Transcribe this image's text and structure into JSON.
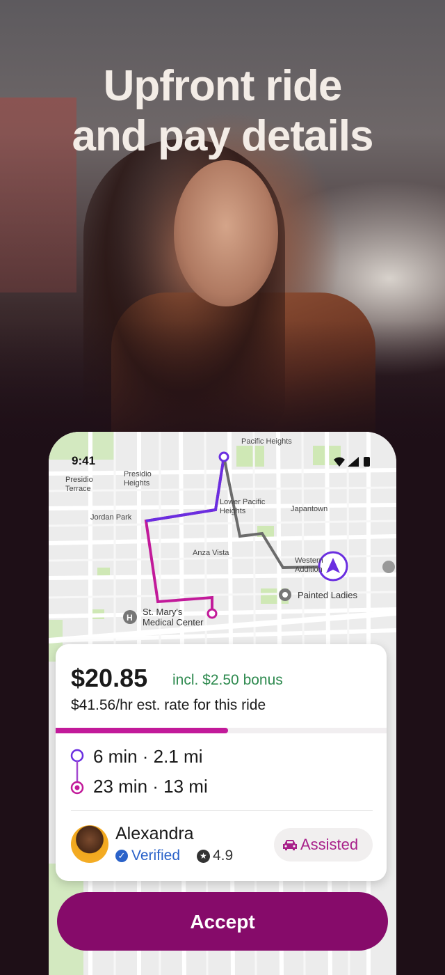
{
  "headline": {
    "line1": "Upfront ride",
    "line2": "and pay details"
  },
  "status_bar": {
    "time": "9:41"
  },
  "map": {
    "labels": {
      "pacific_heights": "Pacific Heights",
      "presidio_terrace": "Presidio\nTerrace",
      "presidio_heights": "Presidio\nHeights",
      "lower_pacific_heights": "Lower Pacific\nHeights",
      "japantown": "Japantown",
      "jordan_park": "Jordan Park",
      "anza_vista": "Anza Vista",
      "western_addition": "Western\nAddition",
      "painted_ladies": "Painted Ladies",
      "st_marys": "St. Mary's\nMedical Center"
    },
    "colors": {
      "route_magenta": "#c21a9a",
      "route_purple": "#6a2ee0",
      "route_gray": "#6b6b6b",
      "park": "#cfe8b5"
    }
  },
  "ride_card": {
    "price": "$20.85",
    "bonus": "incl. $2.50 bonus",
    "rate": "$41.56/hr est. rate for this ride",
    "progress": 0.52,
    "pickup": "6 min · 2.1 mi",
    "trip": "23 min · 13 mi",
    "rider": {
      "name": "Alexandra",
      "verified": "Verified",
      "rating": "4.9"
    },
    "tag": "Assisted",
    "colors": {
      "bonus": "#2e8a4f",
      "verified": "#2a62c9",
      "tag": "#a8208a"
    }
  },
  "accept_label": "Accept",
  "colors": {
    "accent": "#860b6a",
    "background": "#1e0f17"
  }
}
